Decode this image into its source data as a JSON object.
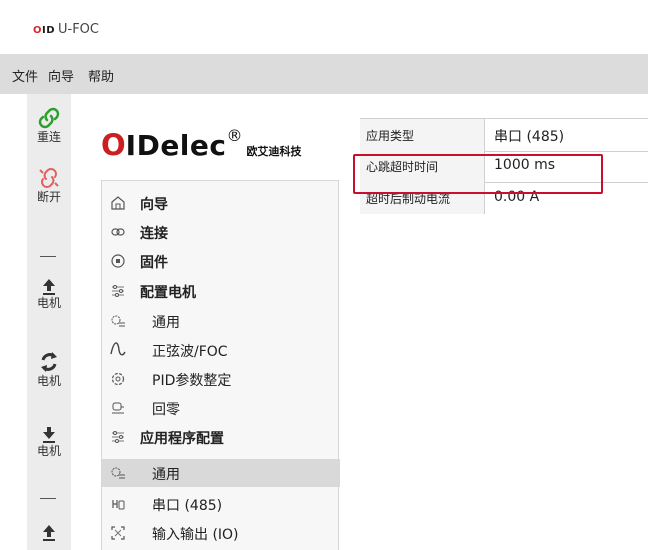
{
  "window": {
    "title": "U-FOC",
    "logo_text": "OID"
  },
  "menu": {
    "items": [
      "文件",
      "向导",
      "帮助"
    ]
  },
  "toolbar": {
    "reconnect_label": "重连",
    "disconnect_label": "断开",
    "upload_motor_label": "电机",
    "sync_motor_label": "电机",
    "download_motor_label": "电机"
  },
  "brand": {
    "o": "O",
    "rest": "IDelec",
    "reg": "®",
    "cn": "欧艾迪科技"
  },
  "nav": {
    "items": [
      {
        "label": "向导",
        "icon": "home-icon"
      },
      {
        "label": "连接",
        "icon": "link-icon"
      },
      {
        "label": "固件",
        "icon": "chip-icon"
      },
      {
        "label": "配置电机",
        "icon": "sliders-icon"
      },
      {
        "label": "通用",
        "icon": "gear-list-icon"
      },
      {
        "label": "正弦波/FOC",
        "icon": "sine-icon"
      },
      {
        "label": "PID参数整定",
        "icon": "cog-icon"
      },
      {
        "label": "回零",
        "icon": "homing-icon"
      },
      {
        "label": "应用程序配置",
        "icon": "sliders-icon"
      },
      {
        "label": "通用",
        "icon": "gear-list-icon"
      },
      {
        "label": "串口 (485)",
        "icon": "serial-icon"
      },
      {
        "label": "输入输出 (IO)",
        "icon": "io-icon"
      }
    ]
  },
  "properties": [
    {
      "key": "应用类型",
      "value": "串口 (485)"
    },
    {
      "key": "心跳超时时间",
      "value": "1000 ms"
    },
    {
      "key": "超时后制动电流",
      "value": "0.00 A"
    }
  ],
  "colors": {
    "accent": "#2ca02c",
    "brand_red": "#cc1f1f",
    "highlight": "#c8102e"
  }
}
